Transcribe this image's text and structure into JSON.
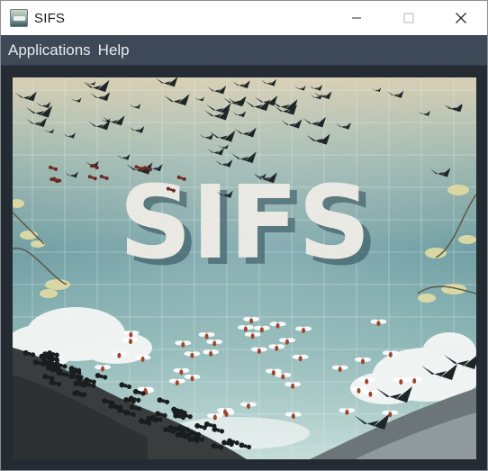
{
  "window": {
    "title": "SIFS",
    "icons": {
      "app": "sifs-app-icon",
      "minimize": "minimize-icon",
      "maximize": "maximize-icon",
      "close": "close-icon"
    }
  },
  "menubar": {
    "items": [
      {
        "label": "Applications"
      },
      {
        "label": "Help"
      }
    ]
  },
  "splash": {
    "logo_text": "SIFS",
    "colors": {
      "sky_top": "#d8cfb4",
      "sky_mid": "#7fa9ab",
      "sky_low": "#a9c9c6",
      "logo_fill": "#f3f1ea",
      "logo_shadow": "#2c4a55",
      "ground": "#3b3f40",
      "grid": "#eaf2f1"
    }
  }
}
